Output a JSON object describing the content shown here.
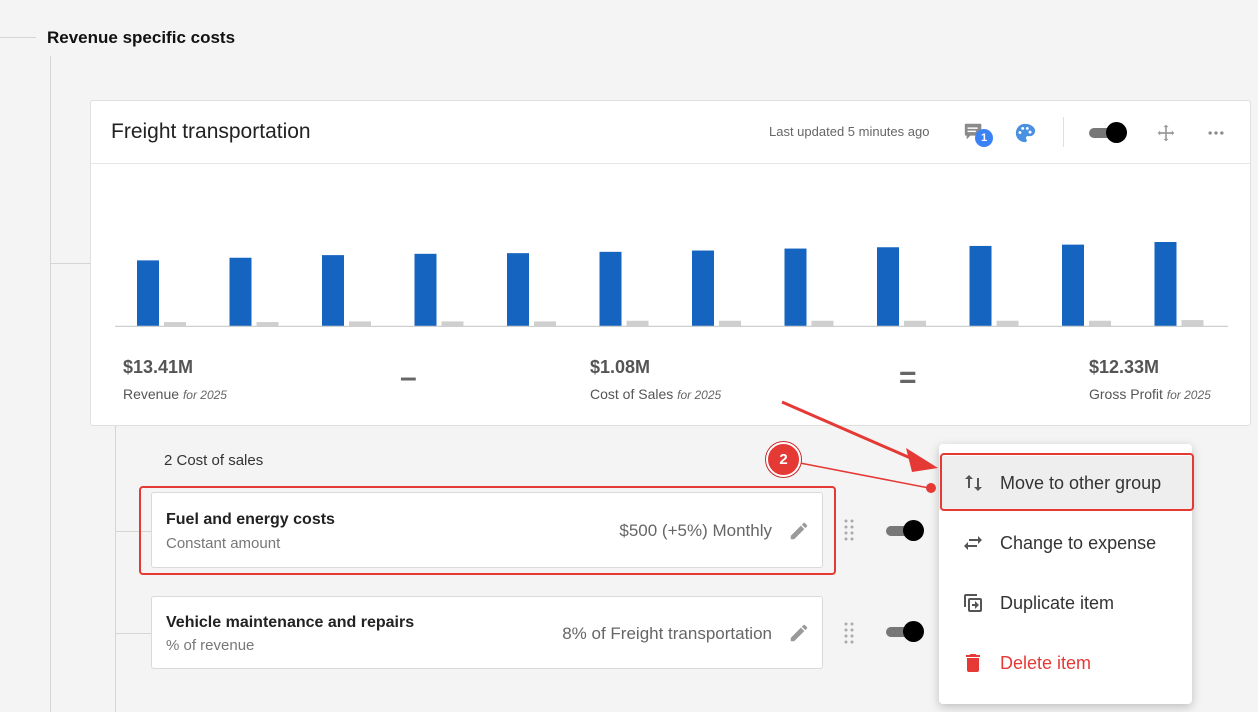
{
  "group": {
    "title": "Revenue specific costs"
  },
  "card": {
    "title": "Freight transportation",
    "last_updated": "Last updated 5 minutes ago",
    "comment_count": "1",
    "toggle_on": true
  },
  "chart_data": {
    "type": "bar",
    "categories": [
      "",
      "",
      "",
      "",
      "",
      "",
      "",
      "",
      "",
      "",
      "",
      ""
    ],
    "series": [
      {
        "values": [
          1.0,
          1.04,
          1.08,
          1.1,
          1.11,
          1.13,
          1.15,
          1.18,
          1.2,
          1.22,
          1.24,
          1.28
        ]
      },
      {
        "values": [
          0.06,
          0.06,
          0.07,
          0.07,
          0.07,
          0.08,
          0.08,
          0.08,
          0.08,
          0.08,
          0.08,
          0.09
        ]
      }
    ],
    "colors": [
      "#1565c0",
      "#cfcfcf"
    ],
    "grid": false,
    "title": "",
    "xlabel": "",
    "ylabel": ""
  },
  "metrics": {
    "revenue": {
      "value": "$13.41M",
      "label": "Revenue",
      "period": "for 2025"
    },
    "operator_minus": "–",
    "cost_of_sales": {
      "value": "$1.08M",
      "label": "Cost of Sales",
      "period": "for 2025"
    },
    "operator_equals": "=",
    "gross_profit": {
      "value": "$12.33M",
      "label": "Gross Profit",
      "period": "for 2025"
    }
  },
  "cost_list": {
    "count_label": "2 Cost of sales",
    "items": [
      {
        "title": "Fuel and energy costs",
        "subtitle": "Constant amount",
        "amount": "$500 (+5%) Monthly",
        "enabled": true
      },
      {
        "title": "Vehicle maintenance and repairs",
        "subtitle": "% of revenue",
        "amount": "8% of Freight transportation",
        "enabled": true
      }
    ]
  },
  "context_menu": {
    "items": [
      {
        "label": "Move to other group",
        "icon": "swap-vertical-icon"
      },
      {
        "label": "Change to expense",
        "icon": "swap-horizontal-icon"
      },
      {
        "label": "Duplicate item",
        "icon": "duplicate-icon"
      },
      {
        "label": "Delete item",
        "icon": "trash-icon"
      }
    ]
  },
  "annotation": {
    "step": "2"
  },
  "colors": {
    "accent": "#1565c0",
    "danger": "#e53935",
    "badge": "#3b82f6"
  }
}
